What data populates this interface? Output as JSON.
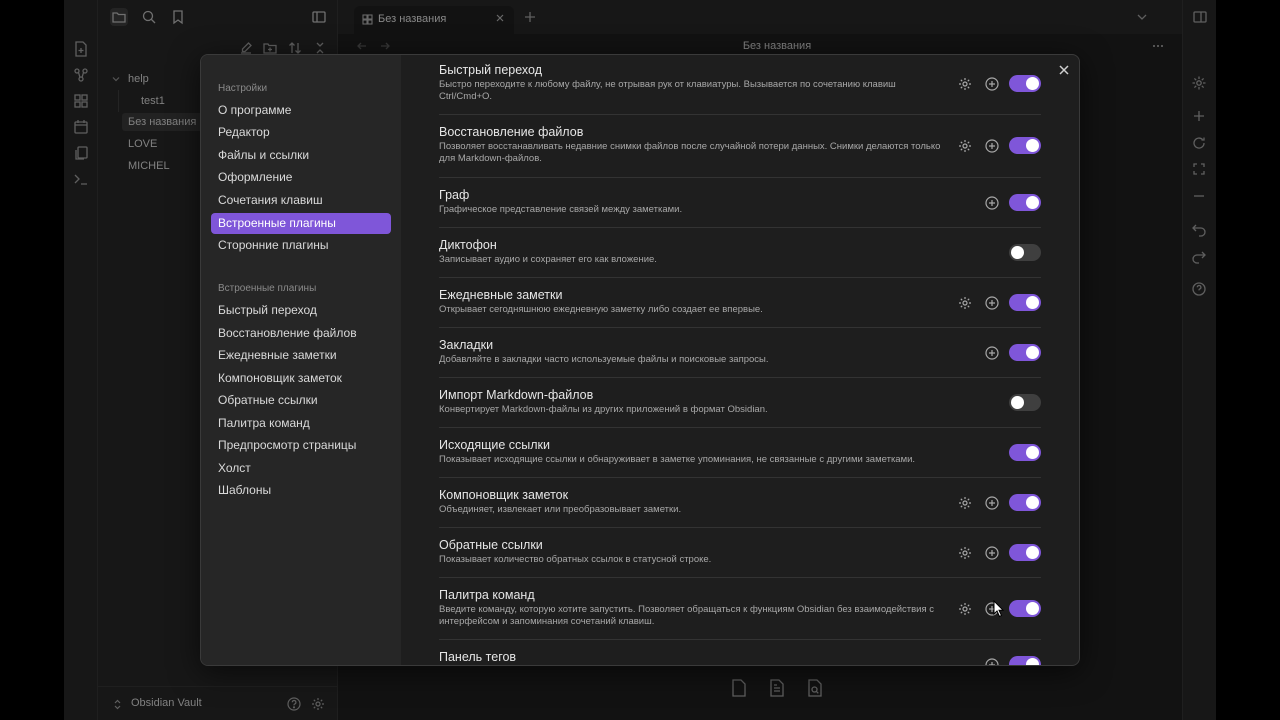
{
  "app": {
    "tab_title": "Без названия",
    "view_title": "Без названия",
    "vault_name": "Obsidian Vault",
    "tree": [
      {
        "label": "help"
      },
      {
        "label": "test1"
      },
      {
        "label": "Без названия"
      },
      {
        "label": "LOVE"
      },
      {
        "label": "MICHEL"
      }
    ]
  },
  "settings": {
    "nav_heading": "Настройки",
    "nav_items": [
      {
        "label": "О программе"
      },
      {
        "label": "Редактор"
      },
      {
        "label": "Файлы и ссылки"
      },
      {
        "label": "Оформление"
      },
      {
        "label": "Сочетания клавиш"
      },
      {
        "label": "Встроенные плагины"
      },
      {
        "label": "Сторонние плагины"
      }
    ],
    "plugins_heading": "Встроенные плагины",
    "plugin_nav": [
      {
        "label": "Быстрый переход"
      },
      {
        "label": "Восстановление файлов"
      },
      {
        "label": "Ежедневные заметки"
      },
      {
        "label": "Компоновщик заметок"
      },
      {
        "label": "Обратные ссылки"
      },
      {
        "label": "Палитра команд"
      },
      {
        "label": "Предпросмотр страницы"
      },
      {
        "label": "Холст"
      },
      {
        "label": "Шаблоны"
      }
    ],
    "plugins": [
      {
        "title": "Быстрый переход",
        "desc": "Быстро переходите к любому файлу, не отрывая рук от клавиатуры. Вызывается по сочетанию клавиш Ctrl/Cmd+O.",
        "enabled": true
      },
      {
        "title": "Восстановление файлов",
        "desc": "Позволяет восстанавливать недавние снимки файлов после случайной потери данных. Снимки делаются только для Markdown-файлов.",
        "enabled": true
      },
      {
        "title": "Граф",
        "desc": "Графическое представление связей между заметками.",
        "enabled": true
      },
      {
        "title": "Диктофон",
        "desc": "Записывает аудио и сохраняет его как вложение.",
        "enabled": false
      },
      {
        "title": "Ежедневные заметки",
        "desc": "Открывает сегодняшнюю ежедневную заметку либо создает ее впервые.",
        "enabled": true
      },
      {
        "title": "Закладки",
        "desc": "Добавляйте в закладки часто используемые файлы и поисковые запросы.",
        "enabled": true
      },
      {
        "title": "Импорт Markdown-файлов",
        "desc": "Конвертирует Markdown-файлы из других приложений в формат Obsidian.",
        "enabled": false
      },
      {
        "title": "Исходящие ссылки",
        "desc": "Показывает исходящие ссылки и обнаруживает в заметке упоминания, не связанные с другими заметками.",
        "enabled": true
      },
      {
        "title": "Компоновщик заметок",
        "desc": "Объединяет, извлекает или преобразовывает заметки.",
        "enabled": true
      },
      {
        "title": "Обратные ссылки",
        "desc": "Показывает количество обратных ссылок в статусной строке.",
        "enabled": true
      },
      {
        "title": "Палитра команд",
        "desc": "Введите команду, которую хотите запустить. Позволяет обращаться к функциям Obsidian без взаимодействия с интерфейсом и запоминания сочетаний клавиш.",
        "enabled": true
      },
      {
        "title": "Панель тегов",
        "desc": "",
        "enabled": true
      }
    ]
  },
  "colors": {
    "accent": "#7f56d9",
    "background": "#1e1e1e",
    "panel": "#262626"
  }
}
